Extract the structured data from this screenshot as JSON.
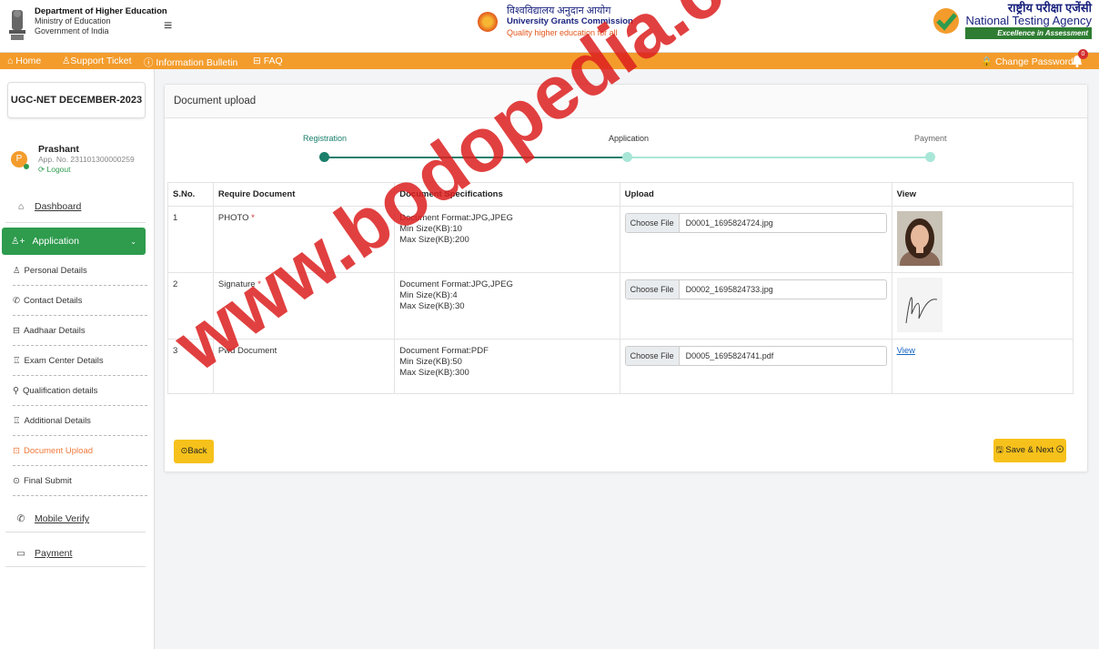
{
  "header": {
    "dept_line1": "Department of Higher Education",
    "dept_line2": "Ministry of Education",
    "dept_line3": "Government of India",
    "ugc_hindi": "विश्वविद्यालय अनुदान आयोग",
    "ugc_english": "University Grants Commission",
    "ugc_tagline": "Quality higher education for all",
    "nta_hindi": "राष्ट्रीय परीक्षा एजेंसी",
    "nta_english": "National Testing Agency",
    "nta_tagline": "Excellence in Assessment"
  },
  "nav": {
    "home": "⌂ Home",
    "support": "♙Support Ticket",
    "bulletin": "ⓘ Information Bulletin",
    "faq": "⊟ FAQ",
    "change_password": "🔒 Change Password",
    "notification_count": "0"
  },
  "sidebar": {
    "exam_title": "UGC-NET DECEMBER-2023",
    "user_initial": "P",
    "user_name": "Prashant",
    "app_no": "App. No. 231101300000259",
    "logout": "⟳ Logout",
    "dashboard": "Dashboard",
    "application": "Application",
    "sub_items": [
      "Personal Details",
      "Contact Details",
      "Aadhaar Details",
      "Exam Center Details",
      "Qualification details",
      "Additional Details",
      "Document Upload",
      "Final Submit"
    ],
    "mobile_verify": "Mobile Verify",
    "payment": "Payment"
  },
  "main": {
    "title": "Document upload",
    "steps": [
      "Registration",
      "Application",
      "Payment"
    ],
    "colors": {
      "green": "#1a7f6b",
      "light": "#a8e6d8",
      "accent": "#2e9b4d",
      "orange": "#f39c2c",
      "yellow": "#f6c11b"
    },
    "table": {
      "headers": [
        "S.No.",
        "Require Document",
        "Document Specifications",
        "Upload",
        "View"
      ],
      "rows": [
        {
          "sno": "1",
          "doc": "PHOTO",
          "spec1": "Document Format:JPG,JPEG",
          "spec2": "Min Size(KB):10",
          "spec3": "Max Size(KB):200",
          "file": "D0001_1695824724.jpg"
        },
        {
          "sno": "2",
          "doc": "Signature",
          "spec1": "Document Format:JPG,JPEG",
          "spec2": "Min Size(KB):4",
          "spec3": "Max Size(KB):30",
          "file": "D0002_1695824733.jpg"
        },
        {
          "sno": "3",
          "doc": "Pwd Document",
          "spec1": "Document Format:PDF",
          "spec2": "Min Size(KB):50",
          "spec3": "Max Size(KB):300",
          "file": "D0005_1695824741.pdf"
        }
      ],
      "choose_file": "Choose File",
      "required_mark": "*",
      "view_link": "View"
    },
    "back": "⊙Back",
    "save_next": "🖫 Save & Next ⊙"
  },
  "watermark": "www.bodopedia.com"
}
